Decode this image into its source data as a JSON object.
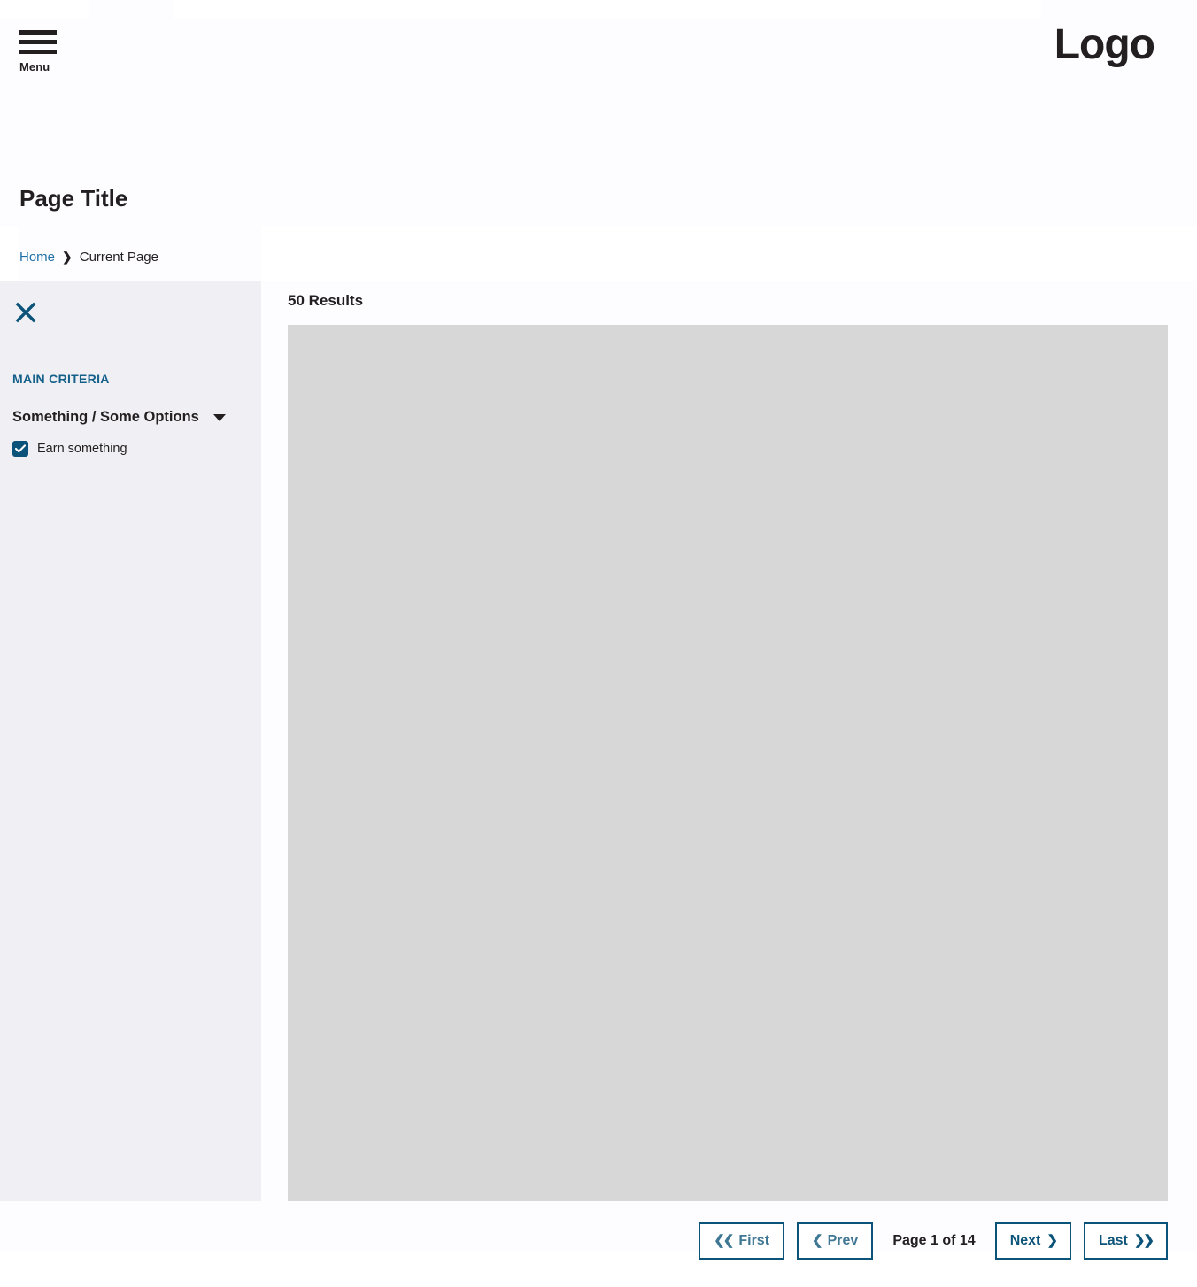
{
  "masthead": {
    "menu_label": "Menu",
    "menu_icon": "hamburger-icon",
    "logo_text": "Logo"
  },
  "page": {
    "title": "Page Title"
  },
  "breadcrumb": {
    "home_label": "Home",
    "separator": "❯",
    "current_label": "Current Page"
  },
  "sidebar": {
    "close_icon": "close-icon",
    "group_heading": "MAIN CRITERIA",
    "facets": [
      {
        "label": "Something / Some Options",
        "caret_icon": "chevron-down-icon",
        "expanded": true,
        "options": [
          {
            "label": "Earn something",
            "checked": true
          }
        ]
      }
    ]
  },
  "results": {
    "count_label": "50 Results",
    "placeholder": ""
  },
  "pagination": {
    "first_label": "First",
    "first_icon": "❮❮",
    "prev_label": "Prev",
    "prev_icon": "❮",
    "status": "Page 1 of 14",
    "next_label": "Next",
    "next_icon": "❯",
    "last_label": "Last",
    "last_icon": "❯❯",
    "current_page": 1,
    "total_pages": 14
  },
  "colors": {
    "accent": "#0b5378",
    "accent_muted": "#3f7794",
    "link": "#1d6fa6",
    "heading": "#146089",
    "sidebar_bg": "#f0f0f4",
    "placeholder_bg": "#d7d7d7",
    "text": "#231f20"
  }
}
